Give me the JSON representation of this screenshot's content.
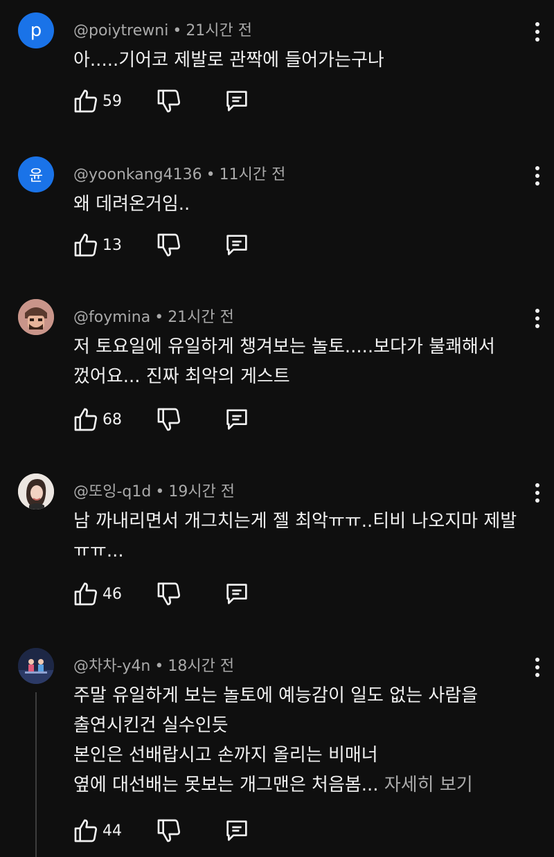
{
  "comments": [
    {
      "avatar_letter": "p",
      "avatar_color": "#1a73e8",
      "username": "@poiytrewni",
      "time": "21시간 전",
      "lines": [
        "아.....기어코 제발로 관짝에 들어가는구나"
      ],
      "likes": "59"
    },
    {
      "avatar_letter": "윤",
      "avatar_color": "#1a73e8",
      "username": "@yoonkang4136",
      "time": "11시간 전",
      "lines": [
        "왜 데려온거임.."
      ],
      "likes": "13"
    },
    {
      "avatar_letter": "",
      "avatar_color": "#b8867a",
      "username": "@foymina",
      "time": "21시간 전",
      "lines": [
        "저 토요일에 유일하게 챙겨보는 놀토.....보다가 불쾌해서",
        "껐어요... 진짜 최악의 게스트"
      ],
      "likes": "68"
    },
    {
      "avatar_letter": "",
      "avatar_color": "#e9e2dc",
      "username": "@또잉-q1d",
      "time": "19시간 전",
      "lines": [
        "남 까내리면서 개그치는게 젤 최악ㅠㅠ..티비 나오지마 제발",
        "ㅠㅠ..."
      ],
      "likes": "46"
    },
    {
      "avatar_letter": "",
      "avatar_color": "#1b2440",
      "username": "@차차-y4n",
      "time": "18시간 전",
      "lines": [
        "주말 유일하게 보는 놀토에 예능감이 일도 없는 사람을",
        "출연시킨건 실수인듯",
        "본인은 선배랍시고 손까지 올리는 비매너",
        "옆에 대선배는 못보는 개그맨은 처음봄... "
      ],
      "more": "자세히 보기",
      "likes": "44"
    }
  ]
}
